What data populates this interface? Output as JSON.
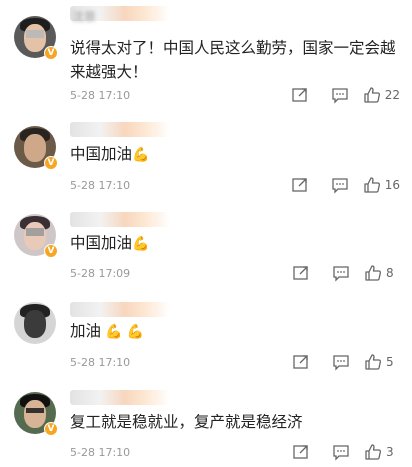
{
  "comments": [
    {
      "username": "沈景",
      "text": "说得太对了！中国人民这么勤劳，国家一定会越来越强大！",
      "time": "5-28 17:10",
      "likes": "22",
      "avatar_bg": "#5a5a5a"
    },
    {
      "username": "",
      "text": "中国加油",
      "emoji": "💪",
      "time": "5-28 17:10",
      "likes": "16",
      "avatar_bg": "#6b5a48"
    },
    {
      "username": "",
      "text": "中国加油",
      "emoji": "💪",
      "time": "5-28 17:09",
      "likes": "8",
      "avatar_bg": "#cfc7c7"
    },
    {
      "username": "",
      "text": "加油",
      "emoji": "💪 💪",
      "time": "5-28 17:10",
      "likes": "5",
      "avatar_bg": "#d5d5d5"
    },
    {
      "username": "",
      "text": "复工就是稳就业，复产就是稳经济",
      "time": "5-28 17:10",
      "likes": "3",
      "avatar_bg": "#556b4f"
    }
  ],
  "icons": {
    "repost": "repost-icon",
    "comment": "comment-icon",
    "like": "thumbs-up-icon",
    "verified": "verified-badge-icon"
  },
  "colors": {
    "verified": "#f6a623",
    "time": "#999999",
    "text": "#222222"
  }
}
